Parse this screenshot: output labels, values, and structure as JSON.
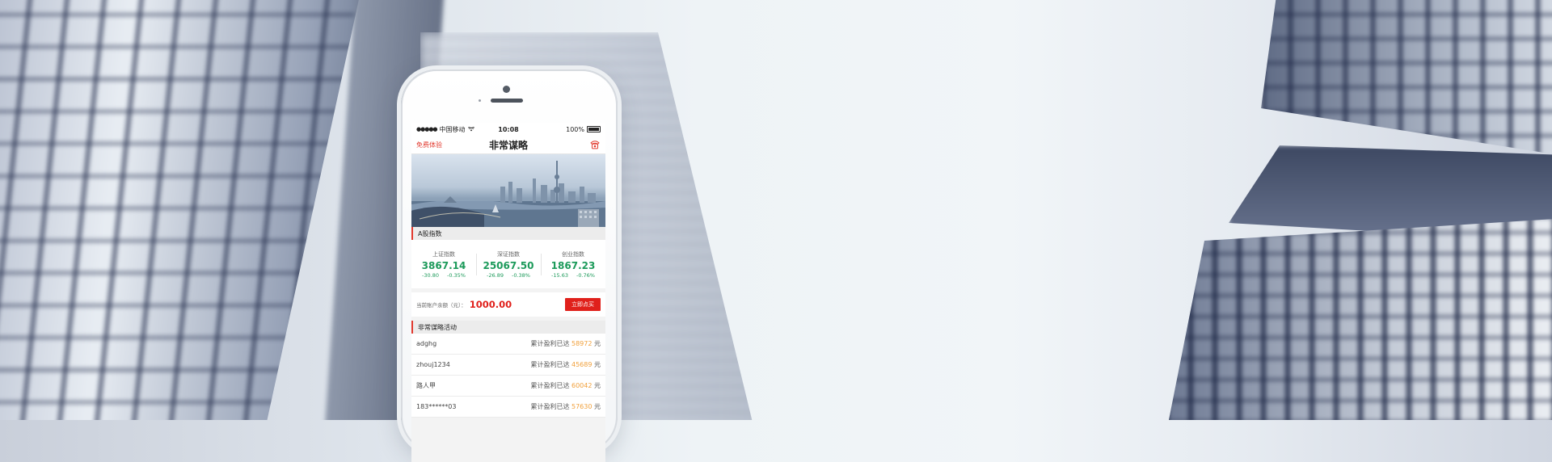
{
  "status_bar": {
    "signal": "●●●●●",
    "carrier": "中国移动",
    "time": "10:08",
    "battery": "100%"
  },
  "nav": {
    "left_link": "免费体验",
    "title": "非常谋略",
    "right_icon": "phone-icon"
  },
  "banner": {
    "icon": "city-skyline-image"
  },
  "indices_section": {
    "title": "A股指数",
    "items": [
      {
        "name": "上证指数",
        "value": "3867.14",
        "change": "-30.80",
        "percent": "-0.35%"
      },
      {
        "name": "深证指数",
        "value": "25067.50",
        "change": "-26.89",
        "percent": "-0.38%"
      },
      {
        "name": "创业指数",
        "value": "1867.23",
        "change": "-15.63",
        "percent": "-0.76%"
      }
    ]
  },
  "balance": {
    "label": "当前账户余额（元）：",
    "value": "1000.00",
    "button": "立即点买"
  },
  "activity": {
    "title": "非常谋略活动",
    "prefix": "累计盈利已达",
    "unit": "元",
    "rows": [
      {
        "name": "adghg",
        "amount": "58972"
      },
      {
        "name": "zhouj1234",
        "amount": "45689"
      },
      {
        "name": "路人甲",
        "amount": "60042"
      },
      {
        "name": "183******03",
        "amount": "57630"
      }
    ]
  },
  "colors": {
    "accent_red": "#e0201b",
    "positive_green": "#1c9a5a",
    "amount_orange": "#f1a03b"
  }
}
